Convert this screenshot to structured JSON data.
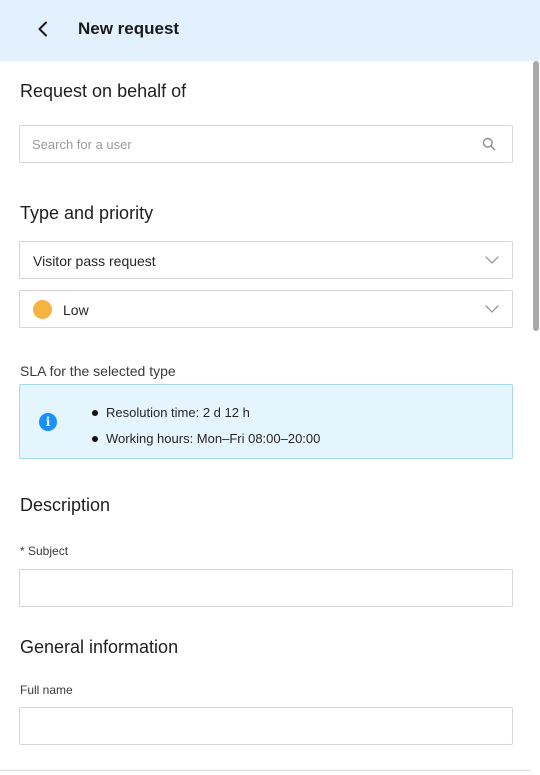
{
  "header": {
    "title": "New request",
    "back_icon": "chevron-left-icon"
  },
  "on_behalf": {
    "title": "Request on behalf of",
    "search_placeholder": "Search for a user",
    "search_icon": "search-icon"
  },
  "type_priority": {
    "title": "Type and priority",
    "type_value": "Visitor pass request",
    "priority_value": "Low",
    "priority_color": "#f5b342"
  },
  "sla": {
    "label": "SLA for the selected type",
    "info_icon": "info-icon",
    "resolution": "Resolution time: 2 d 12 h",
    "working_hours": "Working hours: Mon–Fri 08:00–20:00",
    "box_background": "#e5f5fd",
    "box_border": "#a8d8f0"
  },
  "description": {
    "title": "Description",
    "subject_label": "* Subject",
    "subject_value": ""
  },
  "general": {
    "title": "General information",
    "fullname_label": "Full name",
    "fullname_value": ""
  },
  "colors": {
    "header_background": "#e3f0fd",
    "accent": "#1890ff"
  }
}
